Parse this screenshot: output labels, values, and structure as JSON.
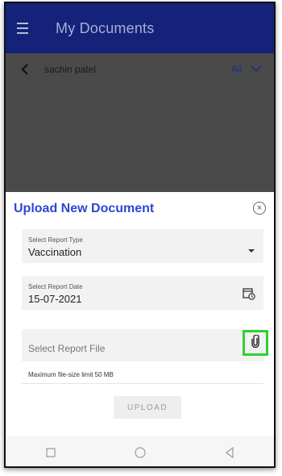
{
  "appbar": {
    "title": "My Documents"
  },
  "subheader": {
    "patient_name": "sachin patel",
    "filter_label": "All"
  },
  "sheet": {
    "title": "Upload New Document",
    "report_type": {
      "label": "Select Report Type",
      "value": "Vaccination"
    },
    "report_date": {
      "label": "Select Report Date",
      "value": "15-07-2021"
    },
    "report_file": {
      "placeholder": "Select Report File"
    },
    "hint": "Maximum file-size limit 50 MB",
    "upload_label": "UPLOAD"
  },
  "colors": {
    "appbar": "#14227a",
    "title_accent": "#2d47d6",
    "highlight_box": "#2fd12f",
    "overlay": "#4a4a4a"
  },
  "icons": [
    "menu-icon",
    "back-arrow-icon",
    "chevron-down-icon",
    "close-circle-icon",
    "dropdown-arrow-icon",
    "calendar-clock-icon",
    "paperclip-icon",
    "nav-recents-icon",
    "nav-home-icon",
    "nav-back-icon"
  ]
}
